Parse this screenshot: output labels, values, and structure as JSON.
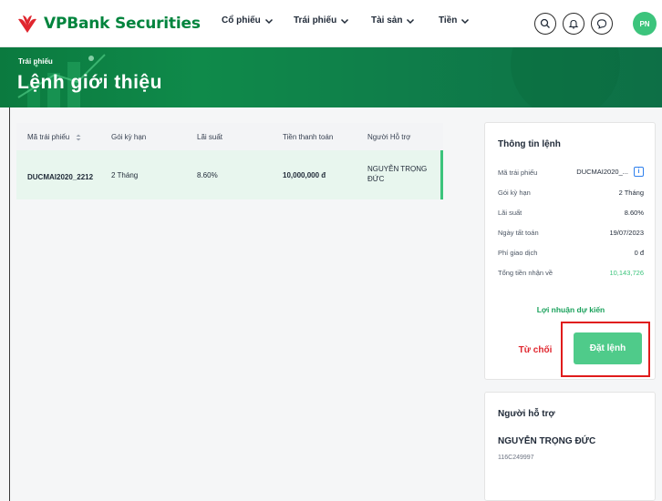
{
  "header": {
    "brand": "VPBank Securities",
    "nav": [
      {
        "label": "Cổ phiếu"
      },
      {
        "label": "Trái phiếu"
      },
      {
        "label": "Tài sản"
      },
      {
        "label": "Tiền"
      }
    ],
    "avatar_initials": "PN",
    "icons": [
      "search-icon",
      "bell-icon",
      "chat-icon"
    ]
  },
  "banner": {
    "breadcrumb": "Trái phiếu",
    "title": "Lệnh giới thiệu"
  },
  "table": {
    "columns": [
      "Mã trái phiếu",
      "Gói kỳ hạn",
      "Lãi suất",
      "Tiền thanh toán",
      "Người Hỗ trợ"
    ],
    "rows": [
      {
        "code": "DUCMAI2020_2212",
        "term": "2 Tháng",
        "rate": "8.60%",
        "amount": "10,000,000 đ",
        "supporter_line1": "NGUYỄN TRỌNG",
        "supporter_line2": "ĐỨC"
      }
    ]
  },
  "order_info": {
    "title": "Thông tin lệnh",
    "rows": [
      {
        "label": "Mã trái phiếu",
        "value": "DUCMAI2020_..."
      },
      {
        "label": "Gói kỳ hạn",
        "value": "2 Tháng"
      },
      {
        "label": "Lãi suất",
        "value": "8.60%"
      },
      {
        "label": "Ngày tất toán",
        "value": "19/07/2023"
      },
      {
        "label": "Phí giao dịch",
        "value": "0 đ"
      },
      {
        "label": "Tổng tiền nhận về",
        "value": "10,143,726"
      }
    ],
    "info_icon_glyph": "i",
    "profit_link": "Lợi nhuận dự kiến",
    "reject_label": "Từ chối",
    "place_order_label": "Đặt lệnh"
  },
  "supporter": {
    "title": "Người hỗ trợ",
    "name": "NGUYỄN TRỌNG ĐỨC",
    "code": "116C249997"
  },
  "colors": {
    "brand_green": "#00843d",
    "accent_green": "#3cc47c",
    "reject_red": "#e0262e",
    "highlight_red": "#e01b1b"
  }
}
